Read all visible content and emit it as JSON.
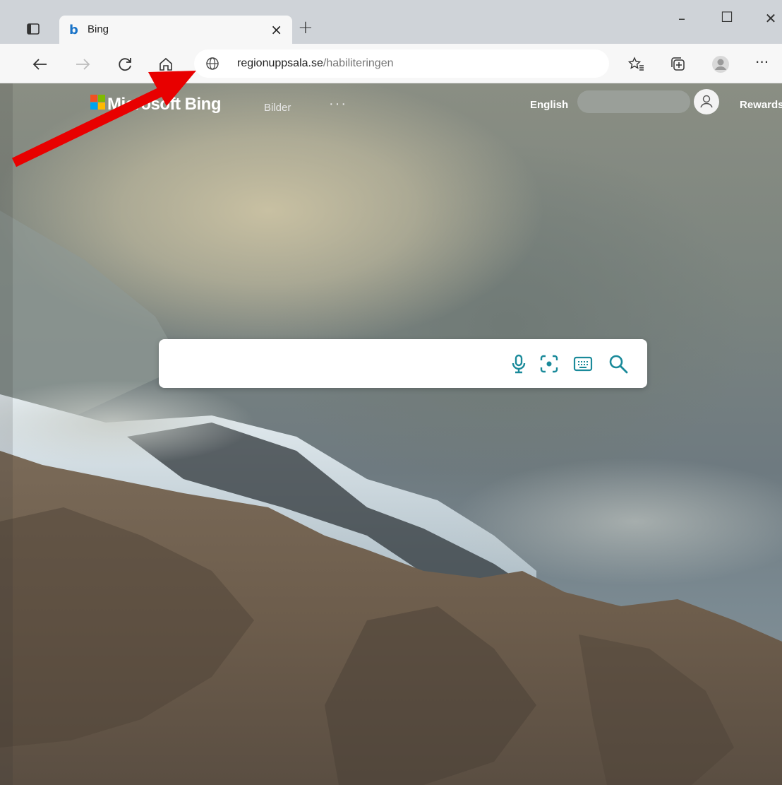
{
  "browser": {
    "tab": {
      "title": "Bing",
      "favicon": "b"
    },
    "window_controls": {
      "minimize": "–",
      "maximize": "☐",
      "close": "✕"
    },
    "address": {
      "host": "regionuppsala.se",
      "path": "/habiliteringen"
    },
    "more_menu": "···"
  },
  "bing": {
    "brand": "Microsoft Bing",
    "nav": {
      "images": "Bilder",
      "more": "···"
    },
    "language": "English",
    "rewards": "Rewards"
  },
  "search": {
    "placeholder": "",
    "value": ""
  },
  "colors": {
    "accent": "#1a8a9a",
    "annotation": "#e80000"
  },
  "icons": [
    "tab-actions-icon",
    "back-icon",
    "forward-icon",
    "refresh-icon",
    "home-icon",
    "globe-icon",
    "favorites-icon",
    "collections-icon",
    "profile-icon",
    "mic-icon",
    "visual-search-icon",
    "keyboard-icon",
    "search-icon"
  ]
}
